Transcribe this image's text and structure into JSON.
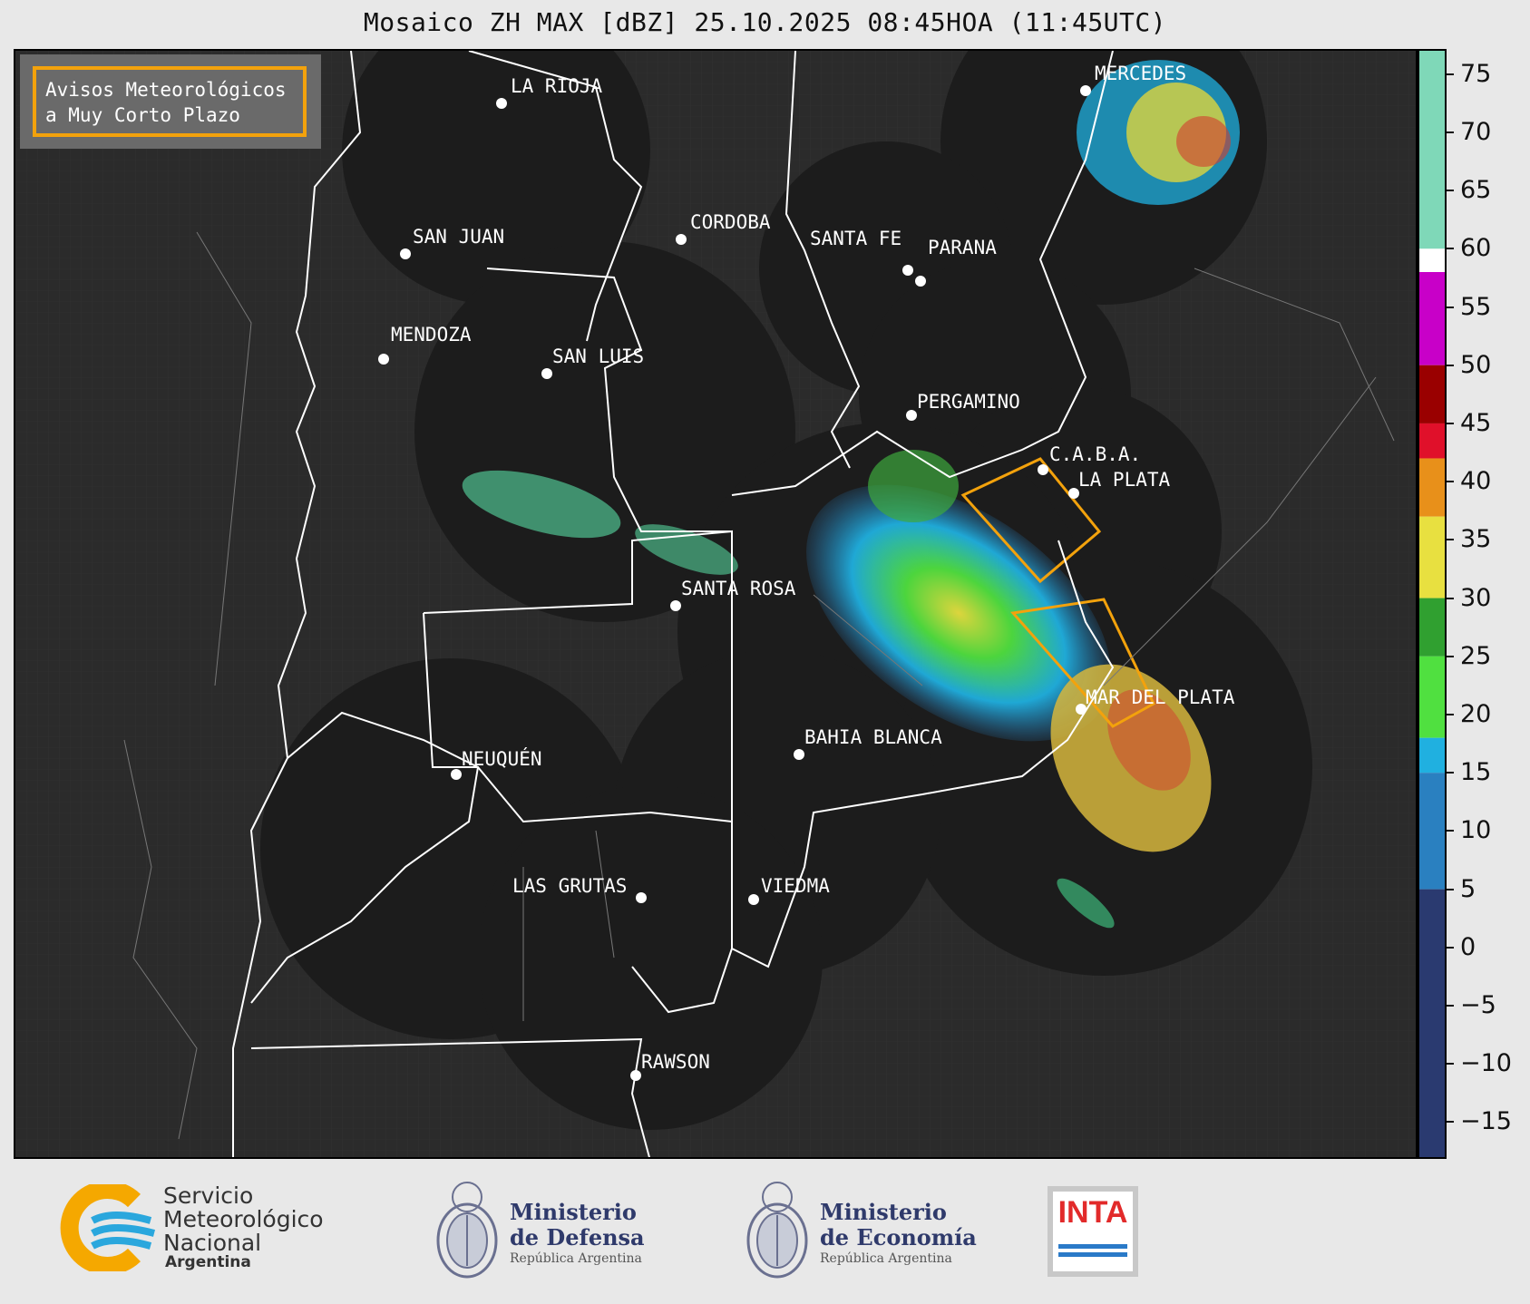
{
  "title": "Mosaico ZH MAX [dBZ] 25.10.2025 08:45HOA (11:45UTC)",
  "legend": {
    "line1": "Avisos Meteorológicos",
    "line2": "a Muy Corto Plazo",
    "border_color": "#f3a20c"
  },
  "colorbar": {
    "ticks": [
      "75",
      "70",
      "65",
      "60",
      "55",
      "50",
      "45",
      "40",
      "35",
      "30",
      "25",
      "20",
      "15",
      "10",
      "5",
      "0",
      "−5",
      "−10",
      "−15"
    ],
    "tick_values": [
      75,
      70,
      65,
      60,
      55,
      50,
      45,
      40,
      35,
      30,
      25,
      20,
      15,
      10,
      5,
      0,
      -5,
      -10,
      -15
    ],
    "range": [
      -18,
      77
    ],
    "colors": {
      "high_teal": "#7fd8b8",
      "white": "#ffffff",
      "magenta": "#c800c8",
      "red": "#e0102a",
      "dark_red": "#9a0000",
      "orange": "#e8901a",
      "yellow": "#e8e040",
      "green": "#30a030",
      "light_green": "#50e040",
      "cyan": "#20b0e0",
      "blue": "#2a80c0",
      "dark_blue": "#2a3a70"
    }
  },
  "cities": [
    {
      "name": "LA RIOJA"
    },
    {
      "name": "SAN JUAN"
    },
    {
      "name": "CORDOBA"
    },
    {
      "name": "SANTA FE"
    },
    {
      "name": "PARANA"
    },
    {
      "name": "MERCEDES"
    },
    {
      "name": "MENDOZA"
    },
    {
      "name": "SAN LUIS"
    },
    {
      "name": "PERGAMINO"
    },
    {
      "name": "C.A.B.A."
    },
    {
      "name": "LA PLATA"
    },
    {
      "name": "SANTA ROSA"
    },
    {
      "name": "MAR DEL PLATA"
    },
    {
      "name": "BAHIA BLANCA"
    },
    {
      "name": "NEUQUÉN"
    },
    {
      "name": "LAS GRUTAS"
    },
    {
      "name": "VIEDMA"
    },
    {
      "name": "RAWSON"
    }
  ],
  "footer": {
    "smn": {
      "line1": "Servicio",
      "line2": "Meteorológico",
      "line3": "Nacional",
      "line4": "Argentina"
    },
    "defensa": {
      "line1": "Ministerio",
      "line2": "de Defensa",
      "line3": "República Argentina"
    },
    "economia": {
      "line1": "Ministerio",
      "line2": "de Economía",
      "line3": "República Argentina"
    },
    "inta": {
      "label": "INTA"
    }
  }
}
